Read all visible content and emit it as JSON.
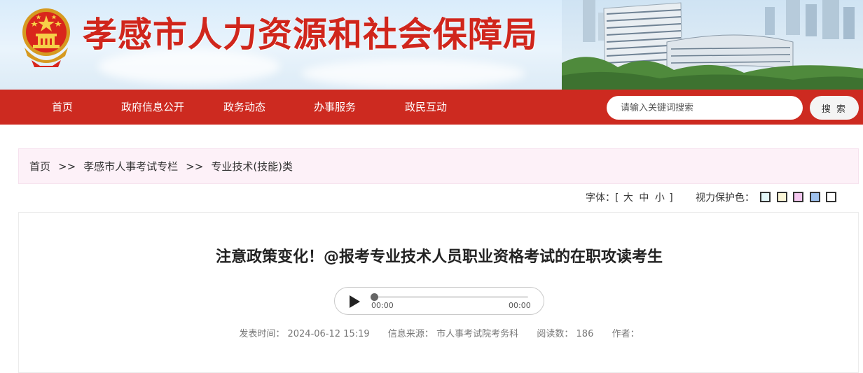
{
  "site": {
    "title": "孝感市人力资源和社会保障局"
  },
  "nav": {
    "items": [
      {
        "label": "首页"
      },
      {
        "label": "政府信息公开"
      },
      {
        "label": "政务动态"
      },
      {
        "label": "办事服务"
      },
      {
        "label": "政民互动"
      }
    ],
    "search_placeholder": "请输入关键词搜索",
    "search_button": "搜 索"
  },
  "breadcrumb": {
    "items": [
      "首页",
      "孝感市人事考试专栏",
      "专业技术(技能)类"
    ],
    "separator": ">>"
  },
  "tools": {
    "font_label": "字体：[",
    "sizes": [
      "大",
      "中",
      "小"
    ],
    "font_close": "]",
    "eye_label": "视力保护色：",
    "swatches": [
      "#e3f6f8",
      "#fbf6d8",
      "#f5c8f0",
      "#9fc2ee",
      "#ffffff"
    ]
  },
  "article": {
    "title": "注意政策变化！@报考专业技术人员职业资格考试的在职攻读考生",
    "audio": {
      "current_time": "00:00",
      "duration": "00:00"
    },
    "meta": {
      "publish_label": "发表时间：",
      "publish_time": "2024-06-12 15:19",
      "source_label": "信息来源：",
      "source": "市人事考试院考务科",
      "views_label": "阅读数：",
      "views": "186",
      "author_label": "作者：",
      "author": ""
    }
  },
  "colors": {
    "brand_red": "#cd2a20",
    "title_red": "#d0261c",
    "breadcrumb_bg": "#fdf1f8"
  }
}
